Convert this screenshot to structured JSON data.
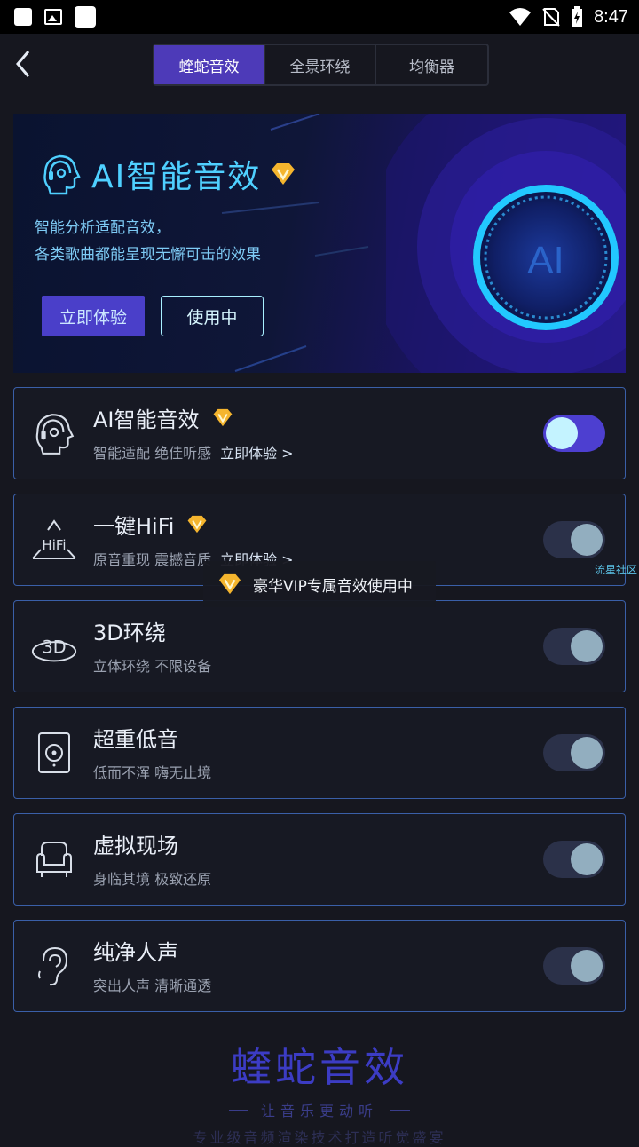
{
  "status_bar": {
    "time": "8:47"
  },
  "nav": {
    "tabs": [
      {
        "label": "蝰蛇音效"
      },
      {
        "label": "全景环绕"
      },
      {
        "label": "均衡器"
      }
    ]
  },
  "banner": {
    "title": "AI智能音效",
    "desc_line1": "智能分析适配音效，",
    "desc_line2": "各类歌曲都能呈现无懈可击的效果",
    "try_label": "立即体验",
    "using_label": "使用中",
    "orb_label": "AI"
  },
  "effects": [
    {
      "title": "AI智能音效",
      "sub": "智能适配 绝佳听感",
      "link": "立即体验 >",
      "vip": true,
      "enabled": true
    },
    {
      "title": "一键HiFi",
      "sub": "原音重现 震撼音质",
      "link": "立即体验 >",
      "vip": true,
      "enabled": false
    },
    {
      "title": "3D环绕",
      "sub": "立体环绕 不限设备",
      "enabled": false
    },
    {
      "title": "超重低音",
      "sub": "低而不浑 嗨无止境",
      "enabled": false
    },
    {
      "title": "虚拟现场",
      "sub": "身临其境 极致还原",
      "enabled": false
    },
    {
      "title": "纯净人声",
      "sub": "突出人声 清晰通透",
      "enabled": false
    }
  ],
  "icons": {
    "hifi_text": "HiFi",
    "3d_text": "3D"
  },
  "toast": {
    "text": "豪华VIP专属音效使用中"
  },
  "watermark": "流星社区",
  "footer": {
    "brand": "蝰蛇音效",
    "slogan": "让音乐更动听",
    "desc": "专业级音频渲染技术打造听觉盛宴"
  },
  "colors": {
    "accent": "#4d3ab8",
    "cyan": "#4fd0ff",
    "card_border": "#3a5fa8",
    "vip_gold": "#f5b52e"
  }
}
